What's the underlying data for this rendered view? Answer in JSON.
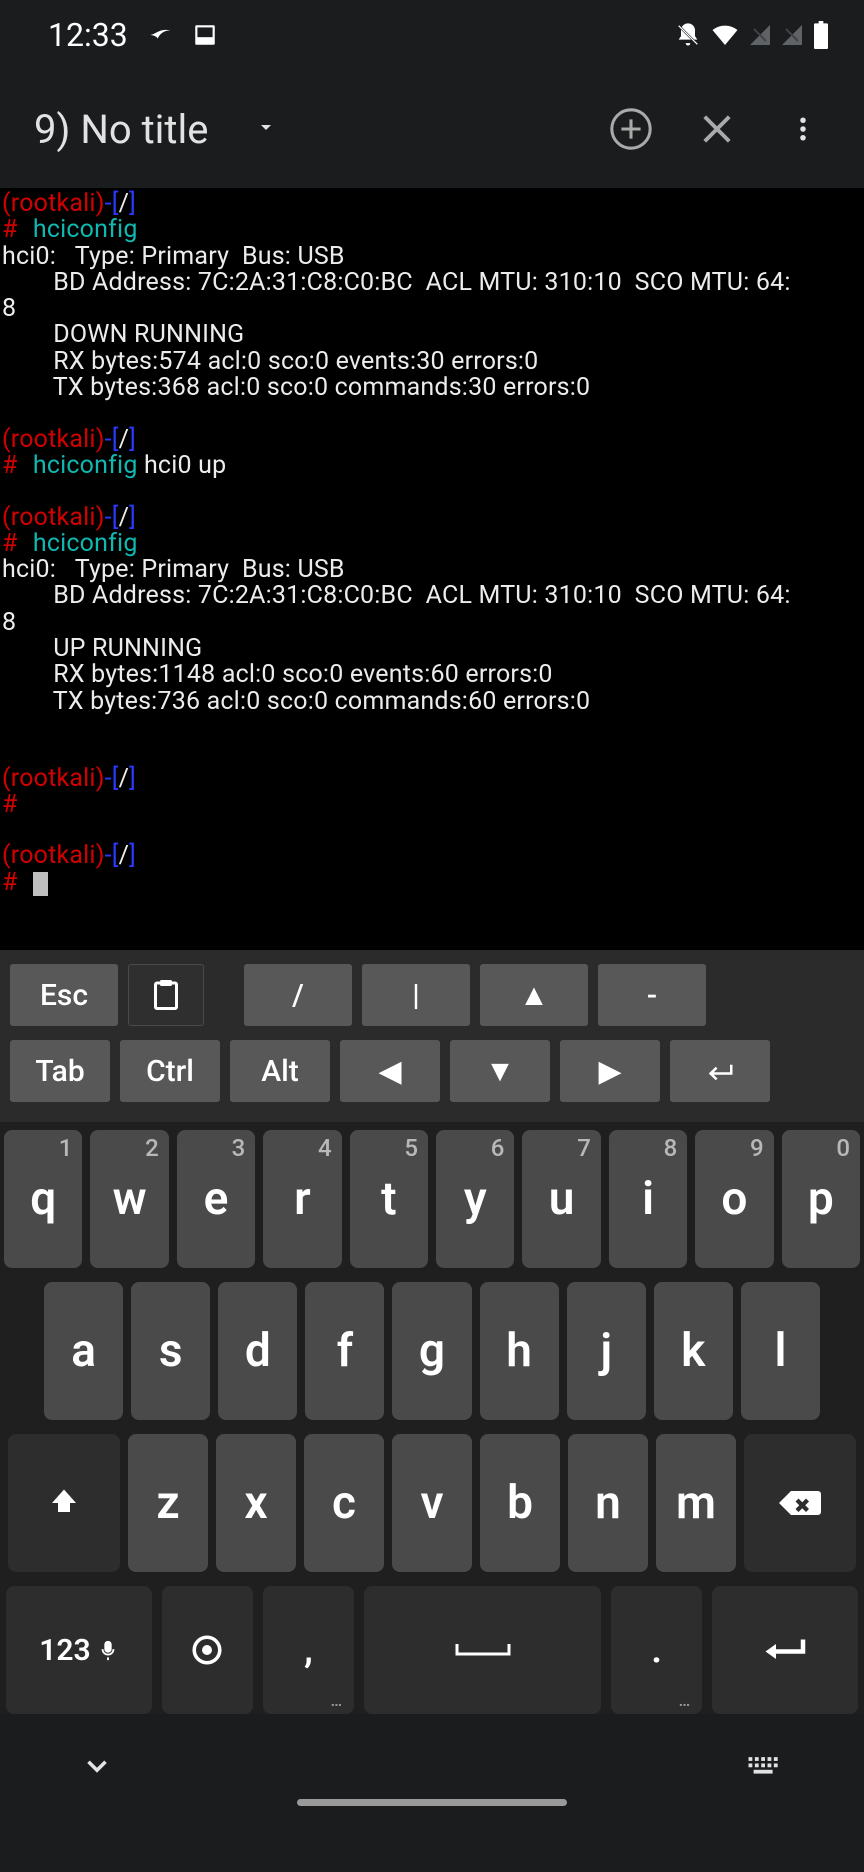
{
  "status": {
    "time": "12:33"
  },
  "appbar": {
    "title": "9) No title"
  },
  "terminal": {
    "p1": {
      "user": "rootkali",
      "path": "/",
      "cmd": "hciconfig"
    },
    "out1": [
      "hci0:   Type: Primary  Bus: USB",
      "        BD Address: 7C:2A:31:C8:C0:BC  ACL MTU: 310:10  SCO MTU: 64:",
      "8",
      "        DOWN RUNNING ",
      "        RX bytes:574 acl:0 sco:0 events:30 errors:0",
      "        TX bytes:368 acl:0 sco:0 commands:30 errors:0"
    ],
    "p2": {
      "user": "rootkali",
      "path": "/",
      "cmd": "hciconfig",
      "arg": " hci0 up"
    },
    "p3": {
      "user": "rootkali",
      "path": "/",
      "cmd": "hciconfig"
    },
    "out3": [
      "hci0:   Type: Primary  Bus: USB",
      "        BD Address: 7C:2A:31:C8:C0:BC  ACL MTU: 310:10  SCO MTU: 64:",
      "8",
      "        UP RUNNING ",
      "        RX bytes:1148 acl:0 sco:0 events:60 errors:0",
      "        TX bytes:736 acl:0 sco:0 commands:60 errors:0"
    ],
    "p4": {
      "user": "rootkali",
      "path": "/"
    },
    "p5": {
      "user": "rootkali",
      "path": "/"
    }
  },
  "extra": {
    "row1": [
      "Esc",
      "",
      "/",
      "|",
      "▲",
      "-"
    ],
    "row2": [
      "Tab",
      "Ctrl",
      "Alt",
      "◀",
      "▼",
      "▶",
      "↵"
    ]
  },
  "keyboard": {
    "r1": [
      {
        "k": "q",
        "n": "1"
      },
      {
        "k": "w",
        "n": "2"
      },
      {
        "k": "e",
        "n": "3"
      },
      {
        "k": "r",
        "n": "4"
      },
      {
        "k": "t",
        "n": "5"
      },
      {
        "k": "y",
        "n": "6"
      },
      {
        "k": "u",
        "n": "7"
      },
      {
        "k": "i",
        "n": "8"
      },
      {
        "k": "o",
        "n": "9"
      },
      {
        "k": "p",
        "n": "0"
      }
    ],
    "r2": [
      "a",
      "s",
      "d",
      "f",
      "g",
      "h",
      "j",
      "k",
      "l"
    ],
    "r3": [
      "z",
      "x",
      "c",
      "v",
      "b",
      "n",
      "m"
    ],
    "r4": {
      "sym": "123",
      "comma": ",",
      "period": "."
    }
  }
}
